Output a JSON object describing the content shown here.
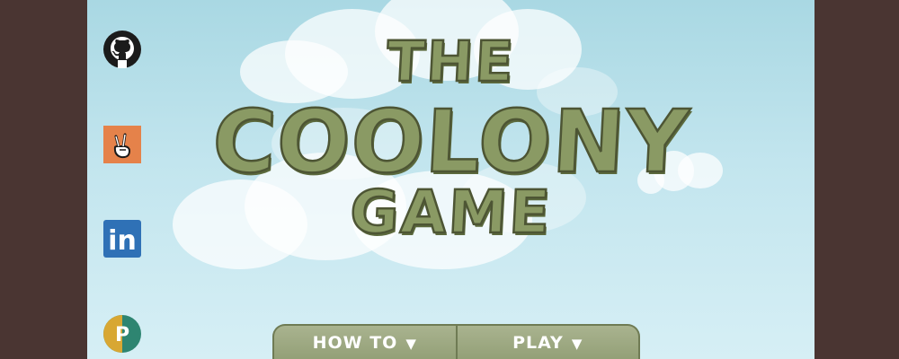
{
  "title": {
    "line1": "THE",
    "line2": "COOLONY",
    "line3": "GAME"
  },
  "social_links": [
    {
      "name": "github",
      "icon": "github-icon"
    },
    {
      "name": "angellist",
      "icon": "peace-hand-icon",
      "color": "#e5824a"
    },
    {
      "name": "linkedin",
      "icon": "linkedin-icon",
      "color": "#2f71b6",
      "label": "in"
    },
    {
      "name": "producthunt",
      "icon": "p-icon",
      "label": "P"
    }
  ],
  "menu": {
    "howto_label": "HOW TO",
    "play_label": "PLAY",
    "arrow": "▼"
  },
  "colors": {
    "frame": "#4a3532",
    "sky_top": "#a9d8e3",
    "title_fill": "#8a9a64",
    "menu_fill": "#9aa67d"
  }
}
